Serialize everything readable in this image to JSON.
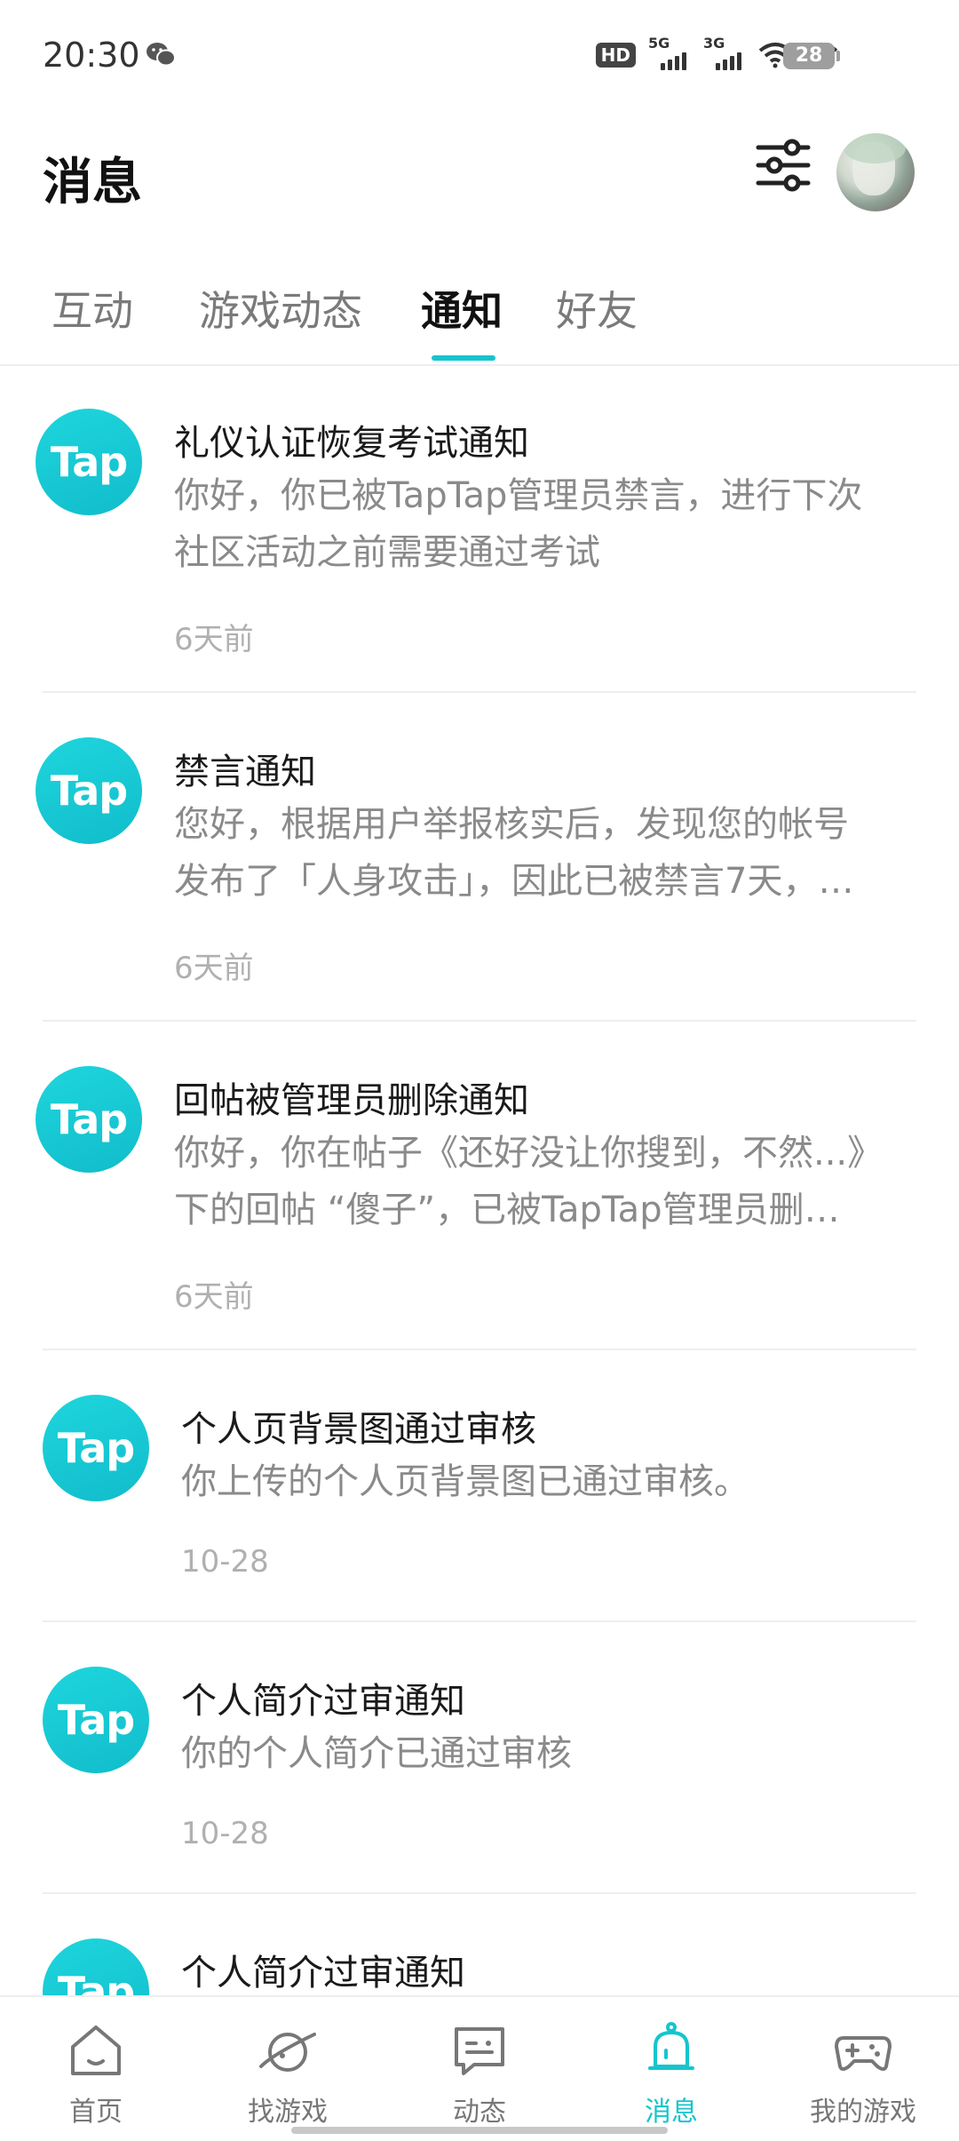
{
  "status_bar": {
    "time": "20:30",
    "hd": "HD",
    "net1": "5G",
    "net2": "3G",
    "battery": "28"
  },
  "header": {
    "title": "消息"
  },
  "tabs": [
    {
      "label": "互动",
      "active": false
    },
    {
      "label": "游戏动态",
      "active": false
    },
    {
      "label": "通知",
      "active": true
    },
    {
      "label": "好友",
      "active": false
    }
  ],
  "notifications": [
    {
      "logo": "Tap",
      "title": "礼仪认证恢复考试通知",
      "body": [
        "你好，你已被TapTap管理员禁言，进行下次",
        "社区活动之前需要通过考试"
      ],
      "time": "6天前"
    },
    {
      "logo": "Tap",
      "title": "禁言通知",
      "body": [
        "您好，根据用户举报核实后，发现您的帐号",
        "发布了「人身攻击」，因此已被禁言7天，…"
      ],
      "time": "6天前"
    },
    {
      "logo": "Tap",
      "title": "回帖被管理员删除通知",
      "body": [
        "你好，你在帖子《还好没让你搜到，不然...》",
        "下的回帖 “傻子”，已被TapTap管理员删…"
      ],
      "time": "6天前"
    },
    {
      "logo": "Tap",
      "title": "个人页背景图通过审核",
      "body": [
        "你上传的个人页背景图已通过审核。"
      ],
      "time": "10-28"
    },
    {
      "logo": "Tap",
      "title": "个人简介过审通知",
      "body": [
        "你的个人简介已通过审核"
      ],
      "time": "10-28"
    },
    {
      "logo": "Tap",
      "title": "个人简介过审通知",
      "body": [],
      "time": ""
    }
  ],
  "bottom_nav": [
    {
      "label": "首页",
      "icon": "home-icon",
      "active": false
    },
    {
      "label": "找游戏",
      "icon": "planet-icon",
      "active": false
    },
    {
      "label": "动态",
      "icon": "chat-icon",
      "active": false
    },
    {
      "label": "消息",
      "icon": "bell-icon",
      "active": true
    },
    {
      "label": "我的游戏",
      "icon": "gamepad-icon",
      "active": false
    }
  ],
  "colors": {
    "accent": "#15c5ce",
    "title": "#1a1a1a",
    "body": "#8a8a8a",
    "time": "#b0b0b0"
  }
}
